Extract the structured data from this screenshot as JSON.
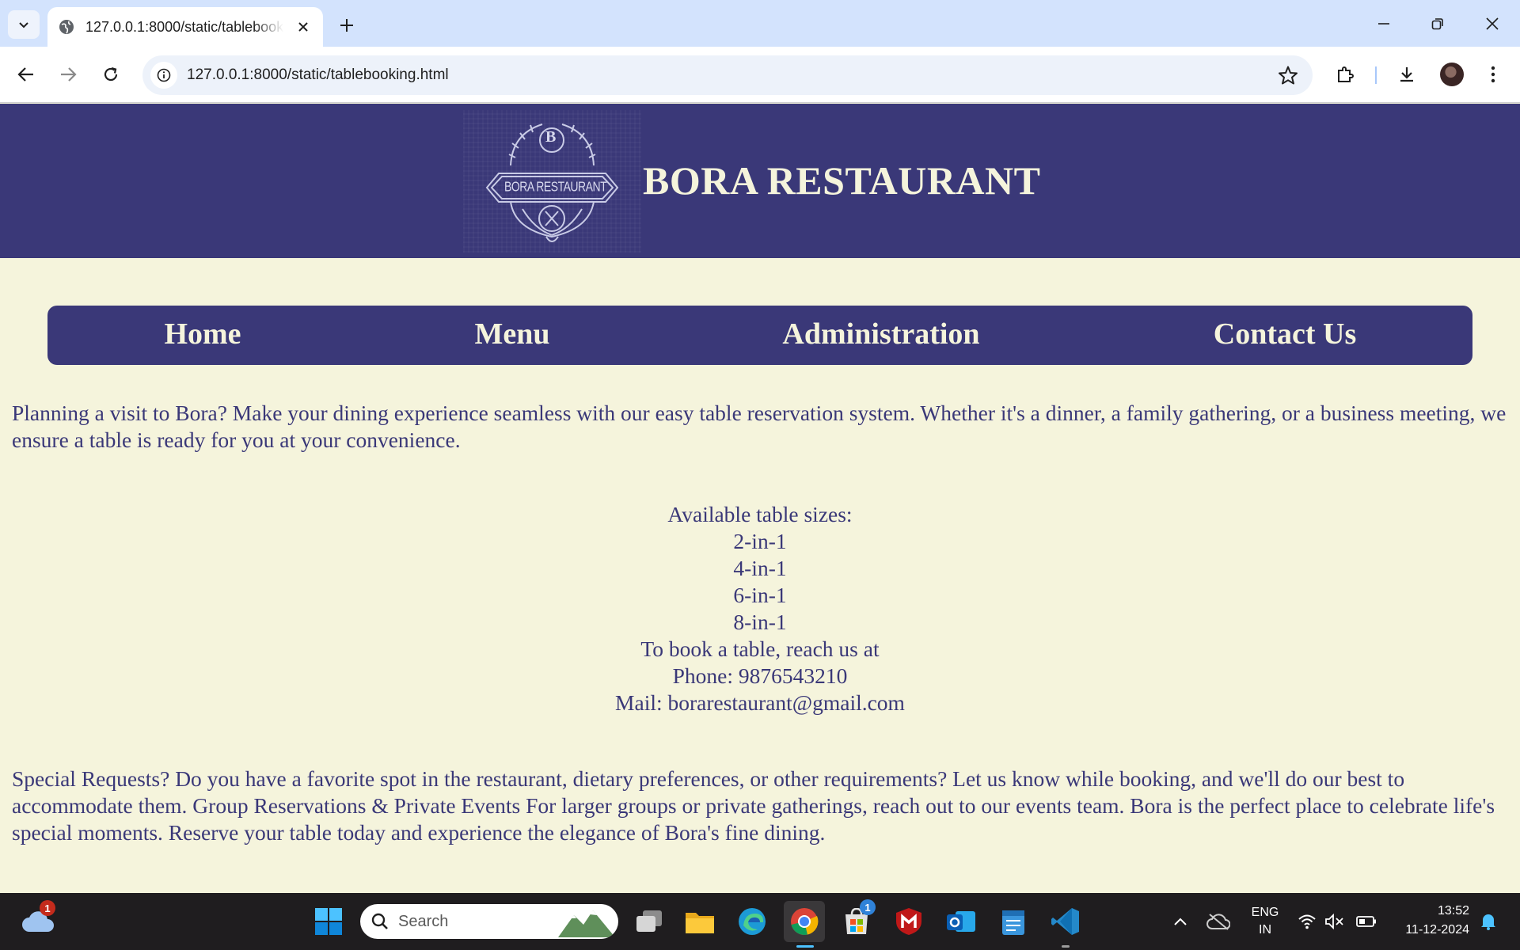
{
  "browser": {
    "tab_title": "127.0.0.1:8000/static/tablebooking.html",
    "url": "127.0.0.1:8000/static/tablebooking.html"
  },
  "header": {
    "logo_letter": "B",
    "logo_text": "BORA RESTAURANT",
    "title": "BORA RESTAURANT"
  },
  "nav": {
    "items": [
      "Home",
      "Menu",
      "Administration",
      "Contact Us"
    ]
  },
  "content": {
    "intro": "Planning a visit to Bora? Make your dining experience seamless with our easy table reservation system. Whether it's a dinner, a family gathering, or a business meeting, we ensure a table is ready for you at your convenience.",
    "table_sizes_heading": "Available table sizes:",
    "table_sizes": [
      "2-in-1",
      "4-in-1",
      "6-in-1",
      "8-in-1"
    ],
    "booking_line": "To book a table, reach us at",
    "phone": "Phone: 9876543210",
    "mail": "Mail: borarestaurant@gmail.com",
    "special": "Special Requests? Do you have a favorite spot in the restaurant, dietary preferences, or other requirements? Let us know while booking, and we'll do our best to accommodate them. Group Reservations & Private Events For larger groups or private gatherings, reach out to our events team. Bora is the perfect place to celebrate life's special moments. Reserve your table today and experience the elegance of Bora's fine dining."
  },
  "taskbar": {
    "search_placeholder": "Search",
    "weather_badge": "1",
    "store_badge": "1",
    "lang_line1": "ENG",
    "lang_line2": "IN",
    "time": "13:52",
    "date": "11-12-2024"
  },
  "colors": {
    "brand_navy": "#3a3878",
    "cream": "#f5f4dc"
  }
}
